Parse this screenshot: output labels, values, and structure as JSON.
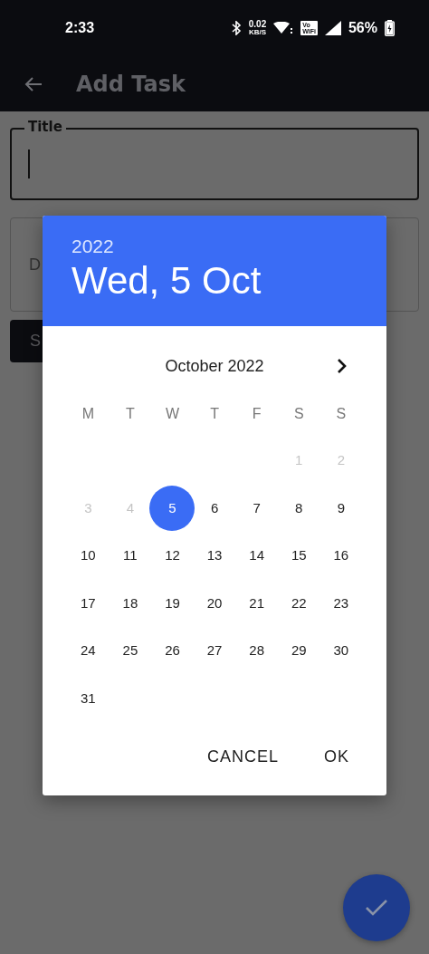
{
  "status_bar": {
    "time": "2:33",
    "speed_value": "0.02",
    "speed_unit": "KB/S",
    "vowifi_top": "Vo",
    "vowifi_bottom": "WiFi",
    "battery": "56%"
  },
  "app_bar": {
    "title": "Add Task"
  },
  "form": {
    "title_field": {
      "label": "Title",
      "focused": true
    },
    "second_field": {
      "label": "D"
    },
    "button": {
      "label": "S"
    }
  },
  "date_picker": {
    "year": "2022",
    "date": "Wed, 5 Oct",
    "month": "October 2022",
    "weekdays": [
      "M",
      "T",
      "W",
      "T",
      "F",
      "S",
      "S"
    ],
    "weeks": [
      [
        {
          "label": "1",
          "disabled": true,
          "selected": false
        },
        {
          "label": "2",
          "disabled": true,
          "selected": false
        }
      ],
      [
        {
          "label": "3",
          "disabled": true,
          "selected": false
        },
        {
          "label": "4",
          "disabled": true,
          "selected": false
        },
        {
          "label": "5",
          "disabled": false,
          "selected": true
        },
        {
          "label": "6",
          "disabled": false,
          "selected": false
        },
        {
          "label": "7",
          "disabled": false,
          "selected": false
        },
        {
          "label": "8",
          "disabled": false,
          "selected": false
        },
        {
          "label": "9",
          "disabled": false,
          "selected": false
        }
      ],
      [
        {
          "label": "10",
          "disabled": false,
          "selected": false
        },
        {
          "label": "11",
          "disabled": false,
          "selected": false
        },
        {
          "label": "12",
          "disabled": false,
          "selected": false
        },
        {
          "label": "13",
          "disabled": false,
          "selected": false
        },
        {
          "label": "14",
          "disabled": false,
          "selected": false
        },
        {
          "label": "15",
          "disabled": false,
          "selected": false
        },
        {
          "label": "16",
          "disabled": false,
          "selected": false
        }
      ],
      [
        {
          "label": "17",
          "disabled": false,
          "selected": false
        },
        {
          "label": "18",
          "disabled": false,
          "selected": false
        },
        {
          "label": "19",
          "disabled": false,
          "selected": false
        },
        {
          "label": "20",
          "disabled": false,
          "selected": false
        },
        {
          "label": "21",
          "disabled": false,
          "selected": false
        },
        {
          "label": "22",
          "disabled": false,
          "selected": false
        },
        {
          "label": "23",
          "disabled": false,
          "selected": false
        }
      ],
      [
        {
          "label": "24",
          "disabled": false,
          "selected": false
        },
        {
          "label": "25",
          "disabled": false,
          "selected": false
        },
        {
          "label": "26",
          "disabled": false,
          "selected": false
        },
        {
          "label": "27",
          "disabled": false,
          "selected": false
        },
        {
          "label": "28",
          "disabled": false,
          "selected": false
        },
        {
          "label": "29",
          "disabled": false,
          "selected": false
        },
        {
          "label": "30",
          "disabled": false,
          "selected": false
        }
      ],
      [
        {
          "label": "31",
          "disabled": false,
          "selected": false
        }
      ]
    ],
    "buttons": [
      "CANCEL",
      "OK"
    ]
  }
}
